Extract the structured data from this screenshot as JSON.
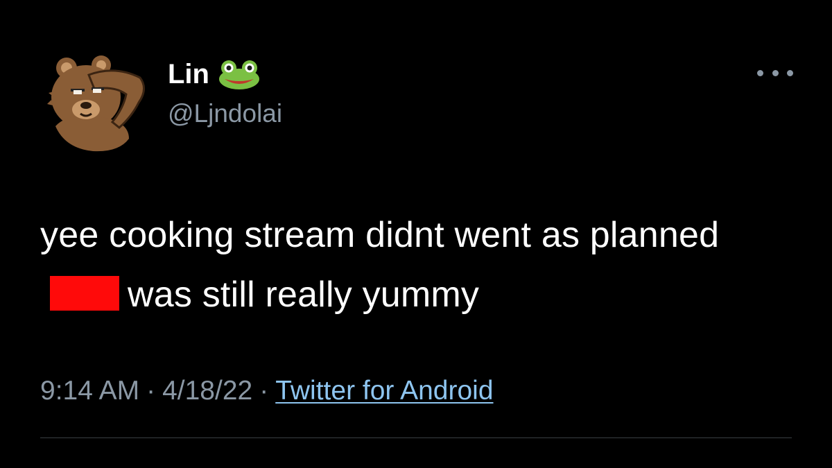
{
  "author": {
    "display_name": "Lin",
    "name_emoji": "frog-emoji",
    "handle": "@Ljndolai",
    "avatar": "bear-saluting-avatar"
  },
  "menu": {
    "icon": "more-horizontal-icon"
  },
  "tweet": {
    "text_before_redaction": "yee cooking stream didnt went as planned",
    "text_after_redaction": "was still really yummy",
    "redaction_color": "#ff0a0a"
  },
  "meta": {
    "time": "9:14 AM",
    "separator": "·",
    "date": "4/18/22",
    "source": "Twitter for Android"
  },
  "colors": {
    "background": "#000000",
    "text": "#ffffff",
    "secondary": "#8b98a5",
    "link": "#8ec5f0"
  }
}
